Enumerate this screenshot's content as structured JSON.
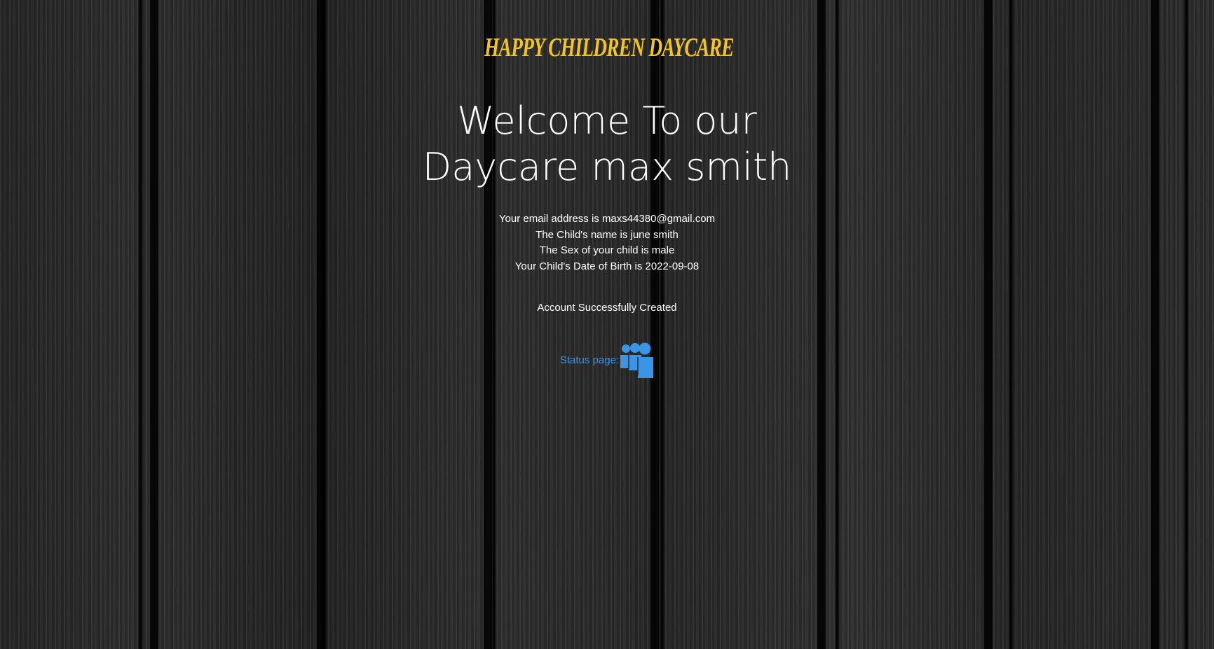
{
  "brand": {
    "name": "HAPPY CHILDREN DAYCARE",
    "color": "#f5c518"
  },
  "welcome": {
    "line1": "Welcome To our",
    "line2": "Daycare max smith"
  },
  "details": {
    "email": "Your email address is maxs44380@gmail.com",
    "child_name": "The Child's name is june smith",
    "child_sex": "The Sex of your child is male",
    "child_dob": "Your Child's Date of Birth is 2022-09-08"
  },
  "status_message": "Account Successfully Created",
  "status_link": {
    "label": "Status page:",
    "icon": "people-group-icon",
    "color": "#3b95e6"
  }
}
